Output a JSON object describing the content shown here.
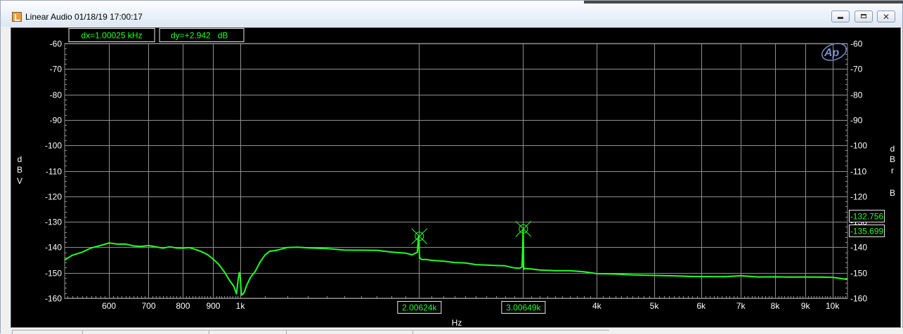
{
  "window": {
    "title": "Linear Audio  01/18/19 17:00:17",
    "close_glyph": "✕",
    "min_icon": "minimize-icon",
    "max_icon": "maximize-icon",
    "close_icon": "close-icon"
  },
  "readouts": {
    "dx": "dx=1.00025 kHz",
    "dy": "dy=+2.942   dB",
    "right_1": "-132.756",
    "right_2": "-135.699"
  },
  "colors": {
    "trace": "#22ff22",
    "grid": "#909090",
    "background": "#000000",
    "axis_text": "#ffffff"
  },
  "chart_data": {
    "type": "line",
    "xscale": "log",
    "xlabel": "Hz",
    "ylabel_left": "dBV",
    "ylabel_right": "dBrB",
    "xlim": [
      505,
      10600
    ],
    "ylim": [
      -160,
      -60
    ],
    "grid": true,
    "yticks": [
      -60,
      -70,
      -80,
      -90,
      -100,
      -110,
      -120,
      -130,
      -140,
      -150,
      -160
    ],
    "yticks_right": [
      -60,
      -70,
      -80,
      -90,
      -100,
      -110,
      -120,
      -130,
      -140,
      -150,
      -160
    ],
    "xticks": [
      {
        "value": 600,
        "label": "600"
      },
      {
        "value": 700,
        "label": "700"
      },
      {
        "value": 800,
        "label": "800"
      },
      {
        "value": 900,
        "label": "900"
      },
      {
        "value": 1000,
        "label": "1k"
      },
      {
        "value": 4000,
        "label": "4k"
      },
      {
        "value": 5000,
        "label": "5k"
      },
      {
        "value": 6000,
        "label": "6k"
      },
      {
        "value": 7000,
        "label": "7k"
      },
      {
        "value": 8000,
        "label": "8k"
      },
      {
        "value": 9000,
        "label": "9k"
      },
      {
        "value": 10000,
        "label": "10k"
      }
    ],
    "cursors": [
      {
        "x": 2006.24,
        "label": "2.00624k",
        "y": -135.7
      },
      {
        "x": 3006.49,
        "label": "3.00649k",
        "y": -132.8
      }
    ],
    "series": [
      {
        "color": "#22ff22",
        "x": [
          505,
          520,
          540,
          560,
          580,
          600,
          620,
          640,
          660,
          680,
          700,
          720,
          740,
          760,
          780,
          800,
          820,
          840,
          860,
          880,
          900,
          920,
          940,
          960,
          975,
          985,
          992,
          996,
          1000,
          1004,
          1008,
          1015,
          1025,
          1040,
          1060,
          1080,
          1100,
          1120,
          1150,
          1200,
          1250,
          1300,
          1400,
          1500,
          1600,
          1700,
          1800,
          1900,
          1950,
          1990,
          1997,
          2000,
          2003,
          2006,
          2009,
          2012,
          2016,
          2025,
          2060,
          2100,
          2200,
          2300,
          2400,
          2500,
          2600,
          2700,
          2800,
          2900,
          2960,
          2990,
          2998,
          3003,
          3006,
          3009,
          3014,
          3022,
          3050,
          3100,
          3200,
          3400,
          3600,
          3800,
          4000,
          4300,
          4600,
          5000,
          5400,
          5800,
          6200,
          6600,
          7000,
          7500,
          8000,
          8500,
          9000,
          9500,
          10000,
          10600
        ],
        "y": [
          -145,
          -143.5,
          -142,
          -140.5,
          -139.5,
          -138.5,
          -139,
          -138.8,
          -139.2,
          -139.5,
          -139.3,
          -139.8,
          -140,
          -139.8,
          -140.2,
          -140.5,
          -140.5,
          -141,
          -142,
          -143,
          -145,
          -147,
          -150,
          -153,
          -155,
          -158,
          -152,
          -149.5,
          -152,
          -158.5,
          -159,
          -158,
          -155,
          -152,
          -149.5,
          -146,
          -143.5,
          -142,
          -141,
          -140,
          -139.8,
          -140.2,
          -140.3,
          -140.8,
          -141,
          -141.5,
          -142,
          -142.5,
          -143,
          -142,
          -138,
          -135.7,
          -137,
          -143,
          -144,
          -144.2,
          -144.3,
          -144.5,
          -144.5,
          -144.8,
          -145.5,
          -146,
          -146.5,
          -146.8,
          -147,
          -147.2,
          -147.5,
          -147.8,
          -148,
          -147.5,
          -140,
          -132.8,
          -138,
          -148,
          -148.3,
          -148.5,
          -148.5,
          -148.8,
          -149,
          -149.2,
          -149.5,
          -149.8,
          -150,
          -150.2,
          -150.5,
          -150.8,
          -151,
          -151.2,
          -151.3,
          -151.5,
          -151.5,
          -151.7,
          -151.8,
          -152,
          -152,
          -152,
          -152.2,
          -152.3
        ]
      }
    ]
  }
}
